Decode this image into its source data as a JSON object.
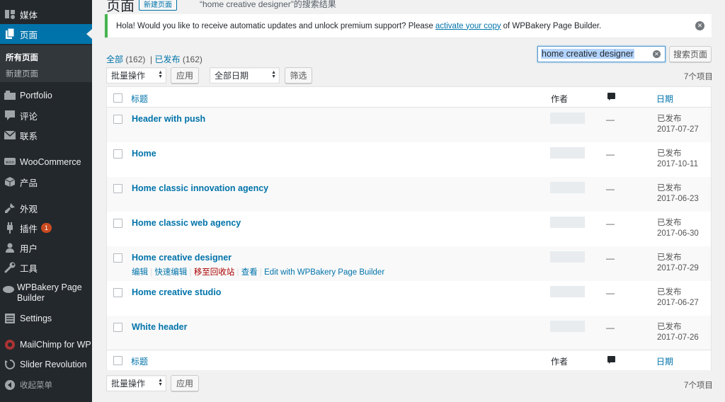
{
  "sidebar": {
    "items": [
      {
        "label": "媒体"
      },
      {
        "label": "页面"
      },
      {
        "label": "Portfolio"
      },
      {
        "label": "评论"
      },
      {
        "label": "联系"
      },
      {
        "label": "WooCommerce"
      },
      {
        "label": "产品"
      },
      {
        "label": "外观"
      },
      {
        "label": "插件",
        "badge": "1"
      },
      {
        "label": "用户"
      },
      {
        "label": "工具"
      },
      {
        "label": "WPBakery Page Builder"
      },
      {
        "label": "Settings"
      },
      {
        "label": "MailChimp for WP"
      },
      {
        "label": "Slider Revolution"
      },
      {
        "label": "收起菜单"
      }
    ],
    "submenu": [
      "所有页面",
      "新建页面"
    ]
  },
  "header": {
    "title": "页面",
    "add_new": "新建页面",
    "search_subtitle": "“home creative designer”的搜索结果"
  },
  "notice": {
    "text_before": "Hola! Would you like to receive automatic updates and unlock premium support? Please",
    "link": "activate your copy",
    "text_after": "of WPBakery Page Builder."
  },
  "filters": {
    "all_label": "全部",
    "all_count": "(162)",
    "separator": "|",
    "published_label": "已发布",
    "published_count": "(162)"
  },
  "search": {
    "value": "home creative designer",
    "button": "搜索页面"
  },
  "tablenav": {
    "bulk_action": "批量操作",
    "apply": "应用",
    "all_dates": "全部日期",
    "filter": "筛选",
    "items_count": "7个项目"
  },
  "table": {
    "columns": {
      "title": "标题",
      "author": "作者",
      "date": "日期"
    },
    "rows": [
      {
        "title": "Header with push",
        "dash": "—",
        "status": "已发布",
        "date": "2017-07-27"
      },
      {
        "title": "Home",
        "dash": "—",
        "status": "已发布",
        "date": "2017-10-11"
      },
      {
        "title": "Home classic innovation agency",
        "dash": "—",
        "status": "已发布",
        "date": "2017-06-23"
      },
      {
        "title": "Home classic web agency",
        "dash": "—",
        "status": "已发布",
        "date": "2017-06-30"
      },
      {
        "title": "Home creative designer",
        "dash": "—",
        "status": "已发布",
        "date": "2017-07-29"
      },
      {
        "title": "Home creative studio",
        "dash": "—",
        "status": "已发布",
        "date": "2017-06-27"
      },
      {
        "title": "White header",
        "dash": "—",
        "status": "已发布",
        "date": "2017-07-26"
      }
    ],
    "row_actions": {
      "edit": "编辑",
      "quick_edit": "快速编辑",
      "trash": "移至回收站",
      "view": "查看",
      "vc_edit": "Edit with WPBakery Page Builder",
      "sep": "|"
    }
  },
  "colors": {
    "sidebar_bg": "#23282d",
    "accent": "#0073aa",
    "notice_border": "#46b450",
    "trash": "#a00",
    "badge": "#ca4a1f"
  }
}
